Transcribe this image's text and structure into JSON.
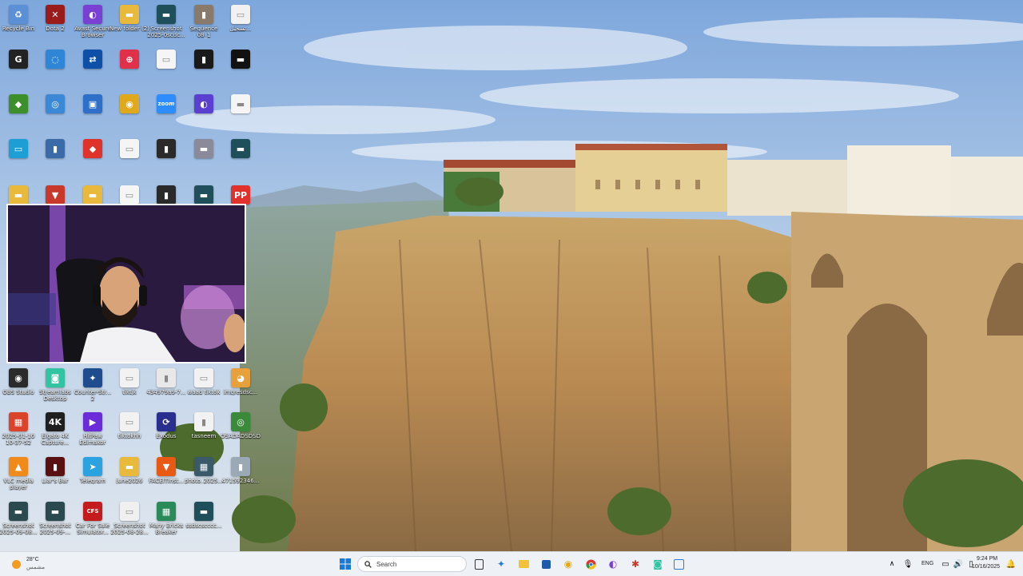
{
  "icons_top": [
    {
      "label": "Recycle Bin",
      "icon": "recycle-bin-icon",
      "color": "#5b8fd6",
      "glyph": "♻"
    },
    {
      "label": "Dota 2",
      "icon": "dota-icon",
      "color": "#9b1b1b",
      "glyph": "✕"
    },
    {
      "label": "Avast Secure Browser",
      "icon": "browser-icon",
      "color": "#7a3fd3",
      "glyph": "◐"
    },
    {
      "label": "New folder (2)",
      "icon": "folder-icon",
      "color": "#e8b93a",
      "glyph": "▬"
    },
    {
      "label": "Screenshot 2025-0scdc...",
      "icon": "image-file-icon",
      "color": "#1e4f5a",
      "glyph": "▬"
    },
    {
      "label": "Sequence 08_1",
      "icon": "video-file-icon",
      "color": "#8a7a6a",
      "glyph": "▮"
    },
    {
      "label": "تسجيل...",
      "icon": "document-icon",
      "color": "#f1f1f1",
      "glyph": "▭"
    }
  ],
  "icons_bottom": [
    {
      "label": "OBS Studio",
      "icon": "obs-icon",
      "color": "#2b2b2b",
      "glyph": "◉"
    },
    {
      "label": "Streamlabs Desktop",
      "icon": "streamlabs-icon",
      "color": "#31c3a2",
      "glyph": "◙"
    },
    {
      "label": "Counter-Str... 2",
      "icon": "counter-strike-icon",
      "color": "#1f4b8f",
      "glyph": "✦"
    },
    {
      "label": "tiktjk",
      "icon": "document-icon",
      "color": "#f2f2f2",
      "glyph": "▭"
    },
    {
      "label": "434979a9-7...",
      "icon": "video-file-icon",
      "color": "#e8e8e8",
      "glyph": "▮"
    },
    {
      "label": "waad tiktok",
      "icon": "document-icon",
      "color": "#f2f2f2",
      "glyph": "▭"
    },
    {
      "label": "imgresdsc...",
      "icon": "image-file-icon",
      "color": "#e8a13a",
      "glyph": "◕"
    },
    {
      "label": "2025-01-10 10-37-52",
      "icon": "video-file-icon",
      "color": "#d9442a",
      "glyph": "▦"
    },
    {
      "label": "Elgato 4K Capture...",
      "icon": "elgato-icon",
      "color": "#1f1f1f",
      "glyph": "4K"
    },
    {
      "label": "HitPaw Edimakor",
      "icon": "hitpaw-icon",
      "color": "#6b2bd9",
      "glyph": "▶"
    },
    {
      "label": "tiktokhh",
      "icon": "document-icon",
      "color": "#f2f2f2",
      "glyph": "▭"
    },
    {
      "label": "Exodus",
      "icon": "exodus-icon",
      "color": "#2a2f8f",
      "glyph": "⟳"
    },
    {
      "label": "tasneem",
      "icon": "document-icon",
      "color": "#f2f2f2",
      "glyph": "▮"
    },
    {
      "label": "OSADADSDSD",
      "icon": "app-icon",
      "color": "#3a8a3a",
      "glyph": "◎"
    },
    {
      "label": "VLC media player",
      "icon": "vlc-icon",
      "color": "#f08a1a",
      "glyph": "▲"
    },
    {
      "label": "Liar's Bar",
      "icon": "game-icon",
      "color": "#5a1010",
      "glyph": "▮"
    },
    {
      "label": "Telegram",
      "icon": "telegram-icon",
      "color": "#2aa3e0",
      "glyph": "➤"
    },
    {
      "label": "june2026",
      "icon": "folder-icon",
      "color": "#e8b93a",
      "glyph": "▬"
    },
    {
      "label": "FACEITInst...",
      "icon": "faceit-icon",
      "color": "#e85a14",
      "glyph": "▼"
    },
    {
      "label": "photo_2025...",
      "icon": "image-file-icon",
      "color": "#3a5a6a",
      "glyph": "▦"
    },
    {
      "label": "471592346...",
      "icon": "image-file-icon",
      "color": "#9aa9b5",
      "glyph": "▮"
    },
    {
      "label": "Screenshot 2025-09-08...",
      "icon": "image-file-icon",
      "color": "#2a4a50",
      "glyph": "▬"
    },
    {
      "label": "Screenshot 2025-09-...",
      "icon": "image-file-icon",
      "color": "#2a4a50",
      "glyph": "▬"
    },
    {
      "label": "Car For Sale Simulator...",
      "icon": "game-icon",
      "color": "#c41c1c",
      "glyph": "CFS"
    },
    {
      "label": "Screenshot 2025-08-28...",
      "icon": "image-file-icon",
      "color": "#f0f0f0",
      "glyph": "▭"
    },
    {
      "label": "Many Bricks Breaker",
      "icon": "game-icon",
      "color": "#2a8a5a",
      "glyph": "▦"
    },
    {
      "label": "ssdscscccc...",
      "icon": "image-file-icon",
      "color": "#1e4f5a",
      "glyph": "▬"
    }
  ],
  "icons_mid": [
    {
      "icon": "g-app-icon",
      "color": "#222",
      "glyph": "G"
    },
    {
      "icon": "app-icon",
      "color": "#2f86d6",
      "glyph": "◌"
    },
    {
      "icon": "teamviewer-icon",
      "color": "#0e4fa8",
      "glyph": "⇄"
    },
    {
      "icon": "app-icon",
      "color": "#e0304a",
      "glyph": "⊕"
    },
    {
      "icon": "document-icon",
      "color": "#f5f5f5",
      "glyph": "▭"
    },
    {
      "icon": "game-icon",
      "color": "#1a1a1a",
      "glyph": "▮"
    },
    {
      "icon": "document-icon",
      "color": "#111",
      "glyph": "▬"
    },
    {
      "icon": "nvidia-icon",
      "color": "#3c8f2a",
      "glyph": "◆"
    },
    {
      "icon": "app-icon",
      "color": "#3a88d6",
      "glyph": "◎"
    },
    {
      "icon": "app-icon",
      "color": "#2d6fc9",
      "glyph": "▣"
    },
    {
      "icon": "chrome-icon",
      "color": "#e0a91c",
      "glyph": "◉"
    },
    {
      "icon": "zoom-icon",
      "color": "#2d8cff",
      "glyph": "zoom"
    },
    {
      "icon": "app-icon",
      "color": "#5b3fd1",
      "glyph": "◐"
    },
    {
      "icon": "document-icon",
      "color": "#f5f5f5",
      "glyph": "▬"
    },
    {
      "icon": "monitor-icon",
      "color": "#1d9fd6",
      "glyph": "▭"
    },
    {
      "icon": "game-icon",
      "color": "#3a6aa8",
      "glyph": "▮"
    },
    {
      "icon": "anydesk-icon",
      "color": "#e0312b",
      "glyph": "◆"
    },
    {
      "icon": "document-icon",
      "color": "#f5f5f5",
      "glyph": "▭"
    },
    {
      "icon": "video-file-icon",
      "color": "#2a2a2a",
      "glyph": "▮"
    },
    {
      "icon": "image-file-icon",
      "color": "#8a8a9a",
      "glyph": "▬"
    },
    {
      "icon": "image-file-icon",
      "color": "#1e4f5a",
      "glyph": "▬"
    },
    {
      "icon": "folder-icon",
      "color": "#e8b93a",
      "glyph": "▬"
    },
    {
      "icon": "faceit-icon",
      "color": "#c8392b",
      "glyph": "▼"
    },
    {
      "icon": "folder-icon",
      "color": "#e8b93a",
      "glyph": "▬"
    },
    {
      "icon": "document-icon",
      "color": "#f5f5f5",
      "glyph": "▭"
    },
    {
      "icon": "video-file-icon",
      "color": "#2a2a2a",
      "glyph": "▮"
    },
    {
      "icon": "image-file-icon",
      "color": "#1e4f5a",
      "glyph": "▬"
    },
    {
      "icon": "pp-icon",
      "color": "#e0312b",
      "glyph": "PP"
    }
  ],
  "taskbar": {
    "weather_temp": "28°C",
    "weather_desc": "مشمس",
    "search_placeholder": "Search",
    "language": "ENG",
    "time": "9:24 PM",
    "date": "10/16/2025"
  }
}
